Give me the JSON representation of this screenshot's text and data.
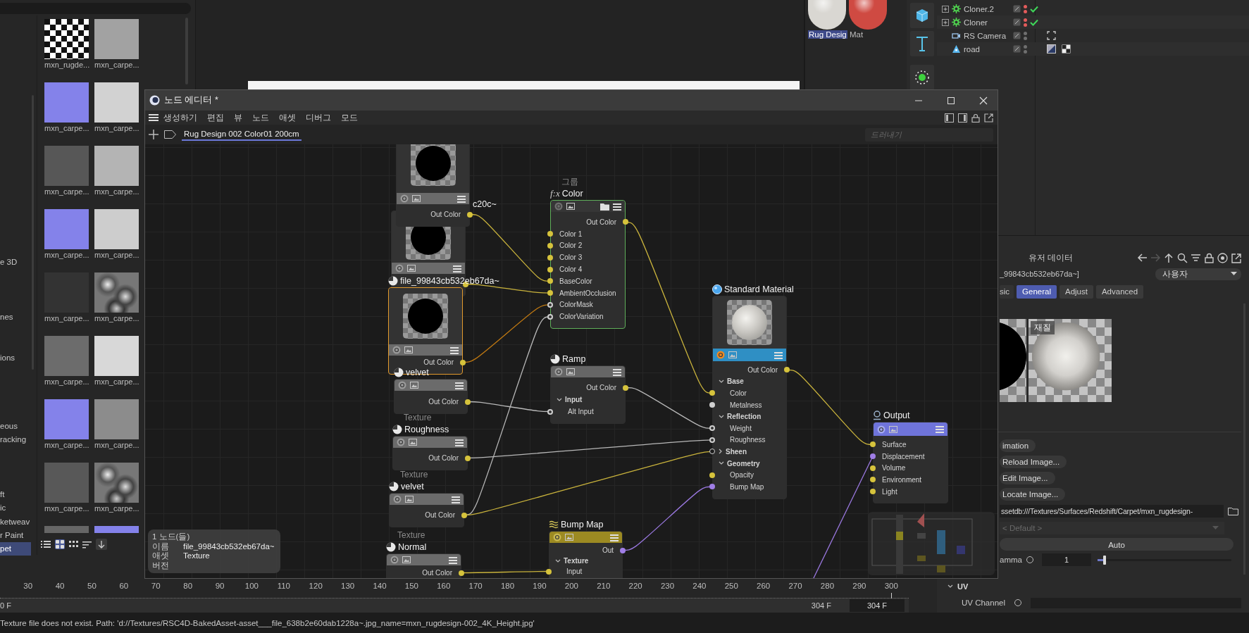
{
  "asset_browser": {
    "categories": [
      {
        "label": "e 3D",
        "selected": false
      },
      {
        "label": "nes",
        "selected": false
      },
      {
        "label": "ions",
        "selected": false
      },
      {
        "label": "eous",
        "selected": false
      },
      {
        "label": "racking",
        "selected": false
      },
      {
        "label": "ft",
        "selected": false
      },
      {
        "label": "ic",
        "selected": false
      },
      {
        "label": "ketweav",
        "selected": false
      },
      {
        "label": "r Paint",
        "selected": false
      },
      {
        "label": "pet",
        "selected": true
      }
    ],
    "assets": [
      {
        "label": "mxn_rugde...",
        "kind": "pattern"
      },
      {
        "label": "mxn_carpe...",
        "kind": "flat",
        "color": "#a2a2a2"
      },
      {
        "label": "mxn_carpe...",
        "kind": "flat",
        "color": "#8482ea"
      },
      {
        "label": "mxn_carpe...",
        "kind": "flat",
        "color": "#d2d2d2"
      },
      {
        "label": "mxn_carpe...",
        "kind": "flat",
        "color": "#575757"
      },
      {
        "label": "mxn_carpe...",
        "kind": "flat",
        "color": "#b4b4b4"
      },
      {
        "label": "mxn_carpe...",
        "kind": "flat",
        "color": "#8482ea"
      },
      {
        "label": "mxn_carpe...",
        "kind": "flat",
        "color": "#cdcdcd"
      },
      {
        "label": "mxn_carpe...",
        "kind": "flat",
        "color": "#333333"
      },
      {
        "label": "mxn_carpe...",
        "kind": "marble"
      },
      {
        "label": "mxn_carpe...",
        "kind": "flat",
        "color": "#6c6c6c"
      },
      {
        "label": "mxn_carpe...",
        "kind": "flat",
        "color": "#d8d8d8"
      },
      {
        "label": "mxn_carpe...",
        "kind": "flat",
        "color": "#8482ea"
      },
      {
        "label": "mxn_carpe...",
        "kind": "flat",
        "color": "#8c8c8c"
      },
      {
        "label": "mxn_carpe...",
        "kind": "flat",
        "color": "#585858"
      },
      {
        "label": "mxn_carpe...",
        "kind": "marble"
      },
      {
        "kind": "flat",
        "color": "#666666"
      },
      {
        "kind": "flat",
        "color": "#8482ea"
      }
    ]
  },
  "material_manager": {
    "materials": [
      {
        "label": "Rug Desig",
        "selected": true,
        "color": "#d9d7d2"
      },
      {
        "label": "Mat",
        "selected": false,
        "color": "#cf4a42"
      }
    ]
  },
  "object_manager": {
    "objects": [
      {
        "name": "Cloner.2",
        "expandable": true,
        "kind": "cloner",
        "color": "#e35b5b",
        "checked": true
      },
      {
        "name": "Cloner",
        "expandable": true,
        "kind": "cloner",
        "color": "#e35b5b",
        "checked": true
      },
      {
        "name": "RS Camera",
        "expandable": false,
        "kind": "camera",
        "color": "#6f6f6f",
        "checked": false,
        "tags": [
          {
            "kind": "target"
          }
        ]
      },
      {
        "name": "road",
        "expandable": false,
        "kind": "mesh",
        "color": "#6f6f6f",
        "checked": false,
        "tags": [
          {
            "kind": "material"
          },
          {
            "kind": "checker"
          }
        ]
      }
    ]
  },
  "node_editor": {
    "title": "노드 에디터 *",
    "menu": [
      "생성하기",
      "편집",
      "뷰",
      "노드",
      "애셋",
      "디버그",
      "모드"
    ],
    "tab": {
      "label": "Rug Design 002 Color01 200cm",
      "selected": true
    },
    "search": {
      "placeholder": "드러내기"
    },
    "nodes": [
      {
        "kind": "texture",
        "selected": false,
        "preview": true,
        "rows": [
          {
            "label": "Out Color",
            "kind": "out_color"
          }
        ]
      },
      {
        "kind": "texture",
        "title": "c20c~",
        "selected": false,
        "preview": true,
        "rows": [
          {
            "kind": "out_color"
          }
        ]
      },
      {
        "kind": "texture",
        "title": "file_99843cb532eb67da~",
        "selected": true,
        "preview": true,
        "rows": [
          {
            "label": "Out Color",
            "kind": "out_color"
          }
        ]
      },
      {
        "kind": "texture",
        "title": "velvet",
        "selected": false,
        "rows": [
          {
            "label": "Out Color",
            "kind": "out_color"
          }
        ]
      },
      {
        "kind": "texture",
        "category": "Texture",
        "title": "Roughness",
        "selected": false,
        "rows": [
          {
            "label": "Out Color",
            "kind": "out_color"
          }
        ]
      },
      {
        "kind": "texture",
        "category": "Texture",
        "title": "velvet",
        "selected": false,
        "rows": [
          {
            "label": "Out Color",
            "kind": "out_color"
          }
        ]
      },
      {
        "kind": "texture",
        "category": "Texture",
        "title": "Normal",
        "selected": false,
        "rows": [
          {
            "label": "Out Color",
            "kind": "out_color"
          }
        ]
      },
      {
        "kind": "group",
        "category": "그룹",
        "icon_text": "f:x",
        "title": "Color",
        "selected": false,
        "rows": [
          {
            "label": "Out Color",
            "kind": "out_color"
          },
          {
            "label": "Color 1",
            "kind": "in_color"
          },
          {
            "label": "Color 2",
            "kind": "in_color"
          },
          {
            "label": "Color 3",
            "kind": "in_color"
          },
          {
            "label": "Color 4",
            "kind": "in_color"
          },
          {
            "label": "BaseColor",
            "kind": "in_color"
          },
          {
            "label": "AmbientOcclusion",
            "kind": "in_color"
          },
          {
            "label": "ColorMask",
            "kind": "in_scalar"
          },
          {
            "label": "ColorVariation",
            "kind": "in_scalar"
          }
        ]
      },
      {
        "kind": "ramp",
        "title": "Ramp",
        "selected": false,
        "rows": [
          {
            "label": "Out Color",
            "kind": "out_color"
          },
          {
            "label": "Input",
            "kind": "group",
            "expanded": true
          },
          {
            "label": "Alt Input",
            "kind": "in_scalar"
          }
        ]
      },
      {
        "kind": "bump",
        "title": "Bump Map",
        "selected": false,
        "rows": [
          {
            "label": "Out",
            "kind": "out_vector"
          },
          {
            "label": "Texture",
            "kind": "group",
            "expanded": true
          },
          {
            "label": "Input",
            "kind": "in_color"
          }
        ]
      },
      {
        "kind": "material",
        "title": "Standard Material",
        "selected": false,
        "preview": true,
        "rows": [
          {
            "label": "Out Color",
            "kind": "out_color"
          },
          {
            "label": "Base",
            "kind": "group",
            "expanded": true
          },
          {
            "label": "Color",
            "kind": "in_color"
          },
          {
            "label": "Metalness",
            "kind": "in_plain"
          },
          {
            "label": "Reflection",
            "kind": "group",
            "expanded": true
          },
          {
            "label": "Weight",
            "kind": "in_scalar"
          },
          {
            "label": "Roughness",
            "kind": "in_scalar"
          },
          {
            "label": "Sheen",
            "kind": "group_in",
            "expanded": false
          },
          {
            "label": "Geometry",
            "kind": "group",
            "expanded": true
          },
          {
            "label": "Opacity",
            "kind": "in_color"
          },
          {
            "label": "Bump Map",
            "kind": "in_vector"
          }
        ]
      },
      {
        "kind": "output",
        "title": "Output",
        "selected": false,
        "rows": [
          {
            "label": "Surface",
            "kind": "in_color"
          },
          {
            "label": "Displacement",
            "kind": "in_vector"
          },
          {
            "label": "Volume",
            "kind": "in_color"
          },
          {
            "label": "Environment",
            "kind": "in_color"
          },
          {
            "label": "Light",
            "kind": "in_color"
          }
        ]
      }
    ],
    "info": {
      "count": "1 노드(들)",
      "fields": [
        {
          "label": "이름",
          "value": "file_99843cb532eb67da~"
        },
        {
          "label": "애셋",
          "value": "Texture"
        },
        {
          "label": "버전"
        }
      ]
    }
  },
  "attribute_manager": {
    "title": "유저 데이터",
    "object": "_99843cb532eb67da~]",
    "mode": "사용자",
    "tabs": [
      {
        "label": "sic",
        "selected": false
      },
      {
        "label": "General",
        "selected": true
      },
      {
        "label": "Adjust",
        "selected": false
      },
      {
        "label": "Advanced",
        "selected": false
      }
    ],
    "preview_label": "재질",
    "buttons": [
      "imation",
      "Reload Image...",
      "Edit Image...",
      "Locate Image..."
    ],
    "path": "ssetdb:///Textures/Surfaces/Redshift/Carpet/mxn_rugdesign-",
    "color_space": {
      "value": "< Default >",
      "disabled": true
    },
    "auto_button": "Auto",
    "gamma": {
      "label": "amma",
      "checked": false,
      "value": "1",
      "level": 0.05
    },
    "uv": {
      "title": "UV",
      "expanded": true,
      "fields": [
        {
          "label": "UV Channel",
          "checked": false
        }
      ]
    }
  },
  "timeline": {
    "ticks": [
      "30",
      "40",
      "50",
      "60",
      "70",
      "80",
      "90",
      "100",
      "110",
      "120",
      "130",
      "140",
      "150",
      "160",
      "170",
      "180",
      "190",
      "200",
      "210",
      "220",
      "230",
      "240",
      "250",
      "260",
      "270",
      "280",
      "290",
      "300"
    ],
    "playhead": {
      "level": 0.981
    },
    "start": "0 F",
    "end": "304 F",
    "end_field": "304 F"
  },
  "status_bar": {
    "message": "Texture file does not exist. Path: 'd://Textures/RSC4D-BakedAsset-asset___file_638b2e60dab1228a~.jpg_name=mxn_rugdesign-002_4K_Height.jpg'"
  }
}
